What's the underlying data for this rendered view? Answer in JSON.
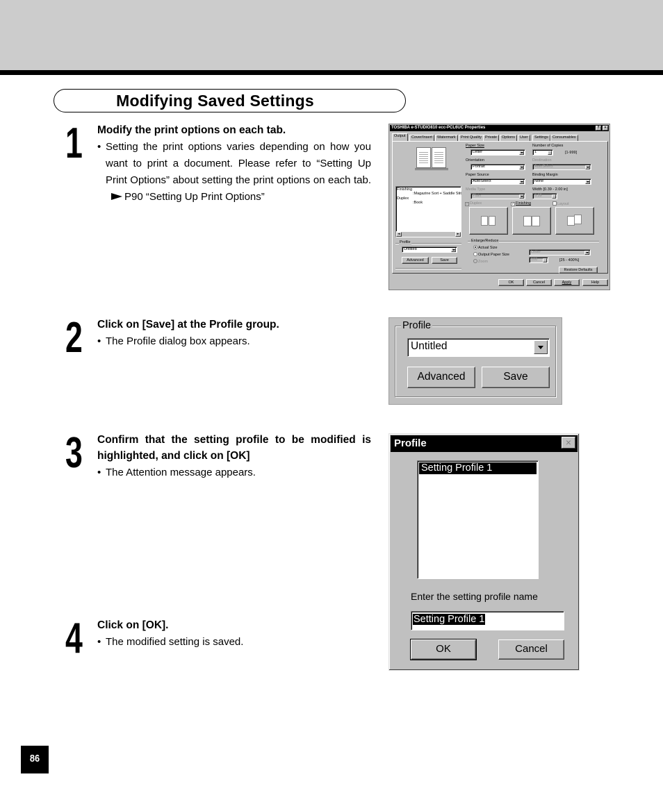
{
  "section_title": "Modifying Saved Settings",
  "steps": [
    {
      "number": "1",
      "heading": "Modify the print options on each tab.",
      "bullet": "Setting the print options varies depending on how you want to print a document.  Please refer to “Setting Up Print Options” about setting the print options on each tab.",
      "reference": "P90 “Setting Up Print Options”"
    },
    {
      "number": "2",
      "heading": "Click on [Save] at the Profile group.",
      "bullet": "The Profile dialog box appears."
    },
    {
      "number": "3",
      "heading": "Confirm that the setting profile to be modified is highlighted, and click on [OK]",
      "bullet": "The Attention message appears."
    },
    {
      "number": "4",
      "heading": "Click on [OK].",
      "bullet": "The modified setting is saved."
    }
  ],
  "properties_dialog": {
    "title": "TOSHIBA e-STUDIO810 ecc-PCL6UC Properties",
    "help_icon": "?",
    "close_icon": "×",
    "tabs": [
      "Output",
      "Cover/Insert",
      "Watermark",
      "Print Quality",
      "Private",
      "Options",
      "User",
      "Settings",
      "Consumables"
    ],
    "active_tab": "Output",
    "paper_size": {
      "label": "Paper Size",
      "value": "Letter"
    },
    "orientation": {
      "label": "Orientation",
      "value": "Portrait"
    },
    "paper_source": {
      "label": "Paper Source",
      "value": "AutoSelect"
    },
    "media_type": {
      "label": "Media Type",
      "value": "Plain"
    },
    "number_of_copies": {
      "label": "Number of Copies",
      "value": "1",
      "range": "[1-999]"
    },
    "destination": {
      "label": "Destination",
      "value": "AutoSelect"
    },
    "binding_margin": {
      "label": "Binding Margin",
      "value": "None"
    },
    "width": {
      "label": "Width [0.39 - 2.00 in]",
      "value": "0.39"
    },
    "checkboxes": {
      "duplex": "Duplex",
      "finishing": "Finishing",
      "layout": "Layout"
    },
    "summary": {
      "finishing_label": "Finishing",
      "finishing_value": ":Magazine Sort + Saddle Stitch",
      "duplex_label": "Duplex",
      "duplex_value": ":Book"
    },
    "profile": {
      "label": "Profile",
      "value": "Untitled",
      "advanced": "Advanced",
      "save": "Save"
    },
    "enlarge_reduce": {
      "label": "Enlarge/Reduce",
      "actual_size": "Actual Size",
      "output_paper_size": "Output Paper Size",
      "zoom": "Zoom",
      "output_paper_value": "Letter",
      "zoom_value": "100",
      "zoom_range": "[25 - 400%]"
    },
    "restore_defaults": "Restore Defaults",
    "buttons": {
      "ok": "OK",
      "cancel": "Cancel",
      "apply": "Apply",
      "help": "Help"
    }
  },
  "profile_group": {
    "label": "Profile",
    "value": "Untitled",
    "advanced": "Advanced",
    "save": "Save"
  },
  "profile_dialog": {
    "title": "Profile",
    "close_icon": "×",
    "list_items": [
      "Setting Profile 1"
    ],
    "name_label": "Enter the setting profile name",
    "name_value": "Setting Profile 1",
    "ok": "OK",
    "cancel": "Cancel"
  },
  "page_number": "86"
}
